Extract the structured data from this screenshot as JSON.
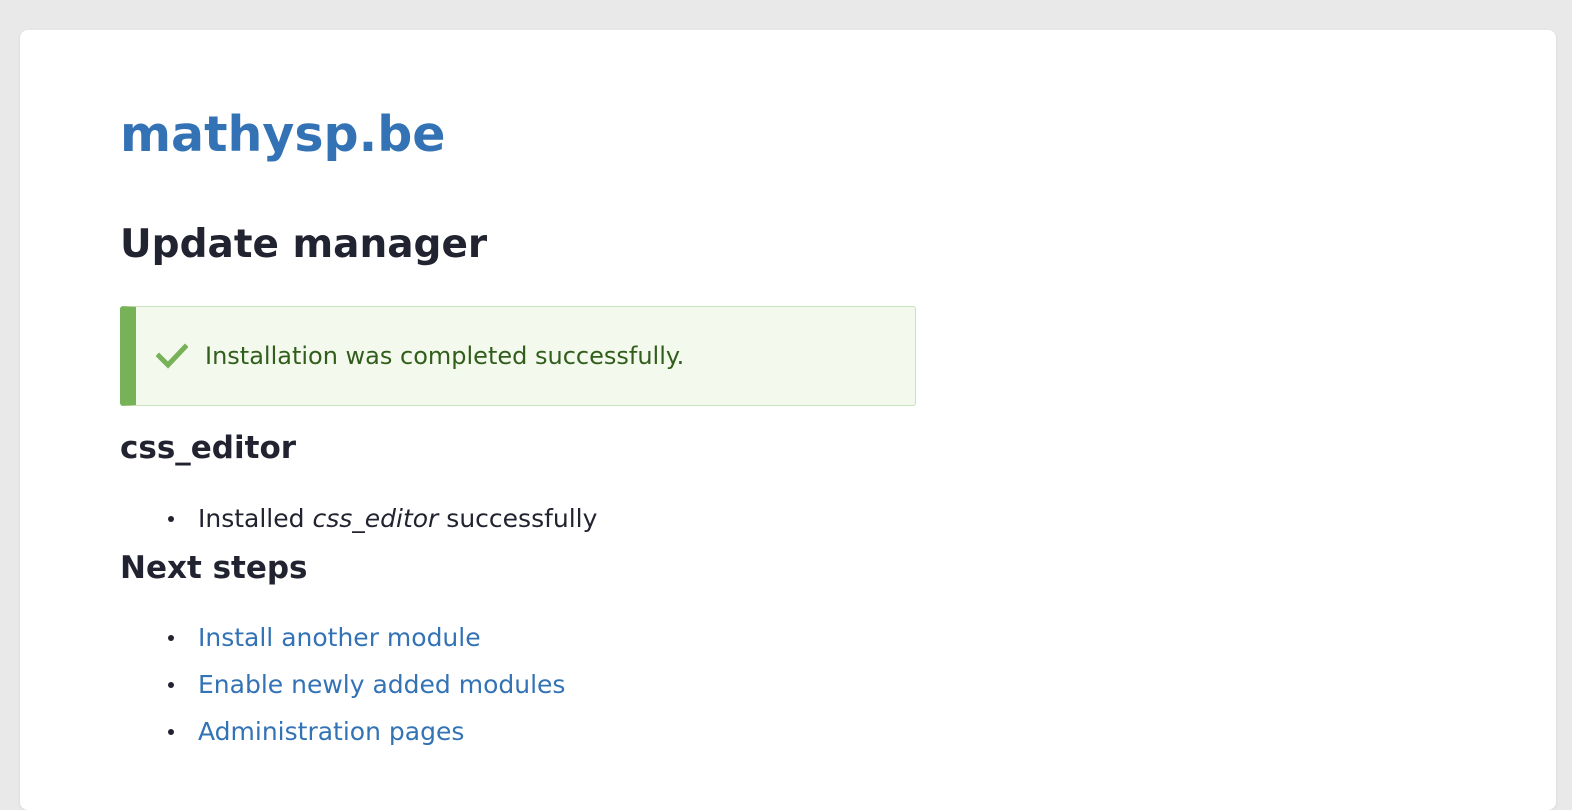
{
  "site": {
    "name": "mathysp.be"
  },
  "page": {
    "title": "Update manager"
  },
  "status_message": {
    "icon": "checkmark-icon",
    "text": "Installation was completed successfully.",
    "accent_color": "#77b259",
    "background_color": "#f3f9ed",
    "text_color": "#325e1c"
  },
  "module_section": {
    "heading": "css_editor",
    "items": [
      {
        "prefix": "Installed",
        "module": "css_editor",
        "suffix": "successfully"
      }
    ]
  },
  "next_steps": {
    "heading": "Next steps",
    "links": [
      {
        "label": "Install another module"
      },
      {
        "label": "Enable newly added modules"
      },
      {
        "label": "Administration pages"
      }
    ]
  },
  "colors": {
    "link": "#3373b5",
    "text": "#222330",
    "page_background": "#e9e9e9",
    "card_background": "#ffffff"
  }
}
